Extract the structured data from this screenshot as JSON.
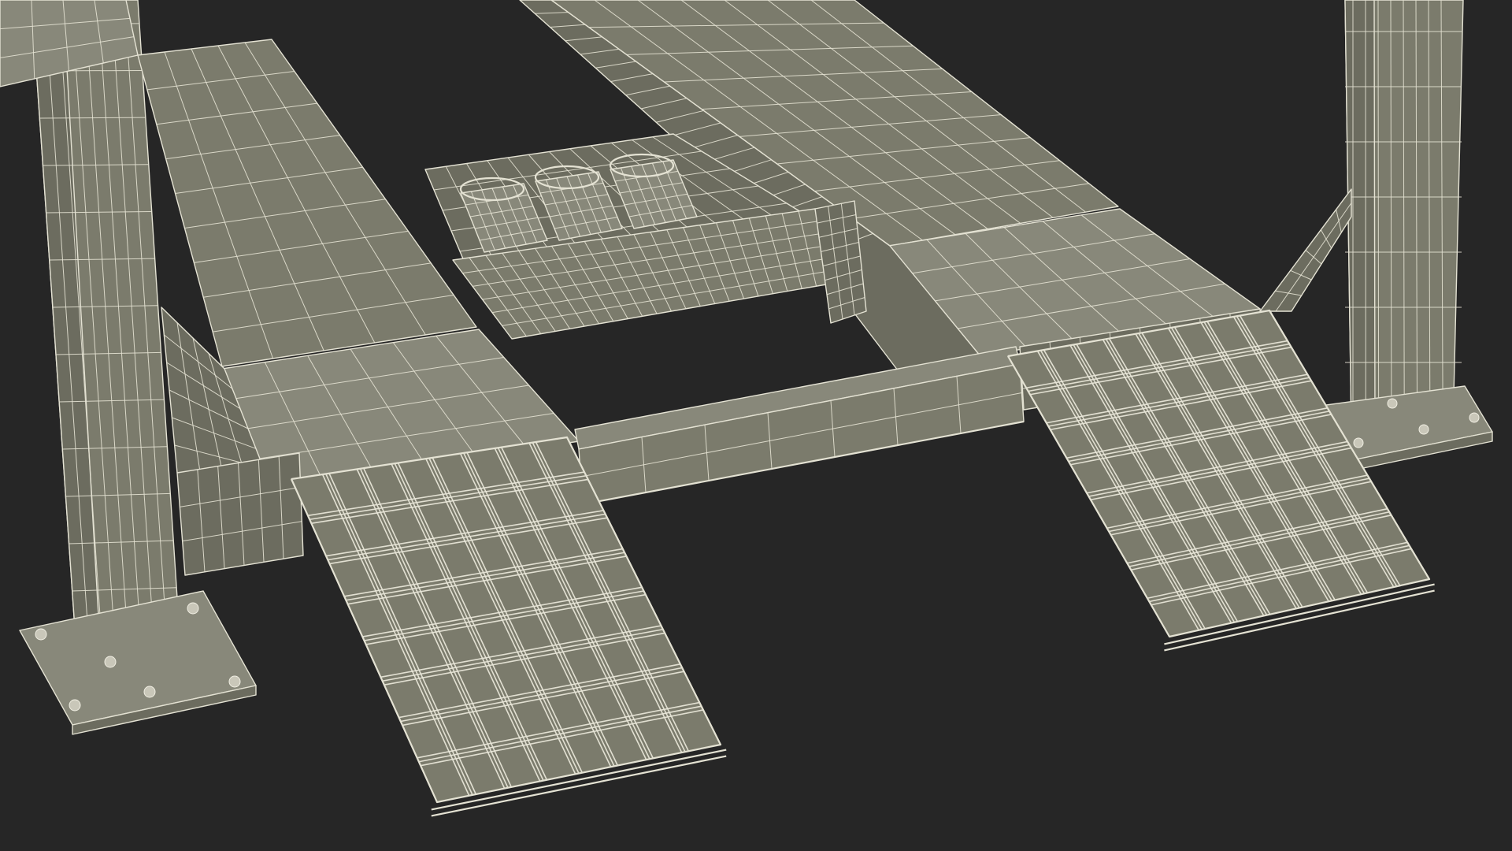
{
  "scene": {
    "subject": "four-post-car-lift",
    "render_style": "wireframe",
    "colors": {
      "background": "#262626",
      "surface": "#7b7b6c",
      "surface_dark": "#6c6c5f",
      "surface_light": "#88887a",
      "wire": "#e4e2d3"
    },
    "parts": [
      "left-column",
      "right-column",
      "left-runway",
      "right-runway",
      "cylinder-unit",
      "cross-beam",
      "left-ramp",
      "right-ramp",
      "left-base-plate",
      "right-base-plate"
    ]
  }
}
